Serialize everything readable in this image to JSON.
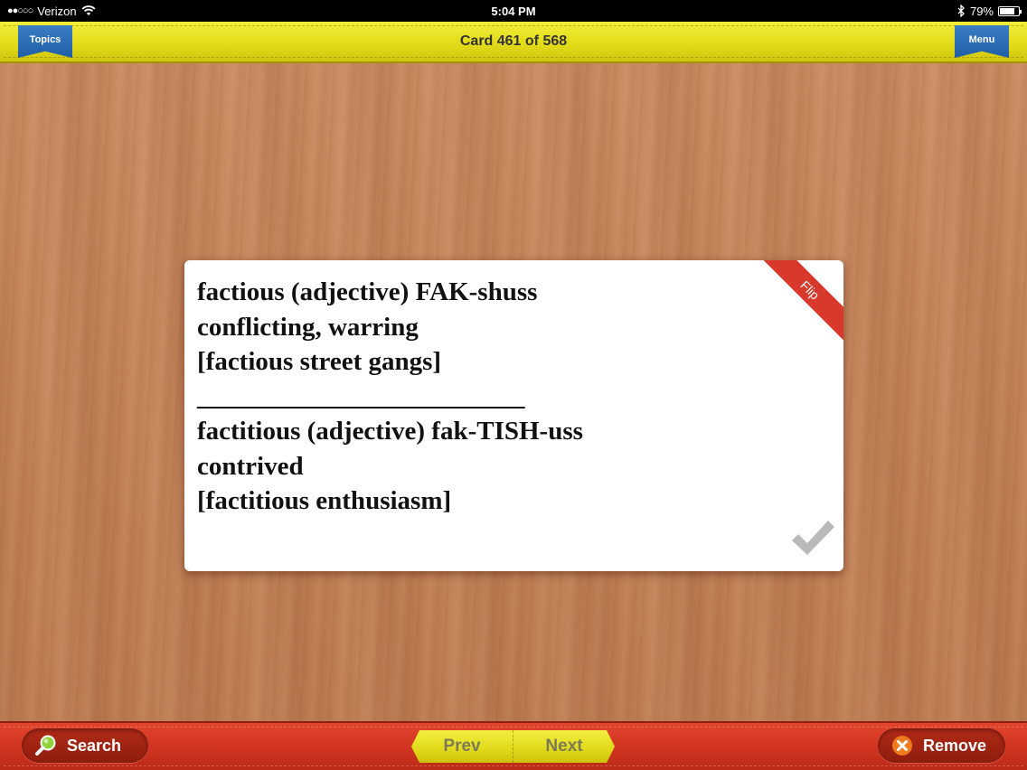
{
  "status_bar": {
    "signal": "●●○○○",
    "carrier": "Verizon",
    "time": "5:04 PM",
    "battery_percent": "79%",
    "battery_level": 0.79
  },
  "top_bar": {
    "topics_label": "Topics",
    "card_counter": "Card 461 of 568",
    "menu_label": "Menu"
  },
  "card": {
    "flip_label": "Flip",
    "lines": [
      "factious (adjective) FAK-shuss",
      "conflicting, warring",
      "[factious street gangs]",
      "_________________________",
      "factitious (adjective) fak-TISH-uss",
      "contrived",
      "[factitious enthusiasm]"
    ]
  },
  "bottom_bar": {
    "search_label": "Search",
    "prev_label": "Prev",
    "next_label": "Next",
    "remove_label": "Remove"
  },
  "colors": {
    "top_bar": "#e3dc1a",
    "bottom_bar": "#cf3420",
    "ribbon_blue": "#1f5ea6",
    "flip_red": "#d8392c"
  }
}
